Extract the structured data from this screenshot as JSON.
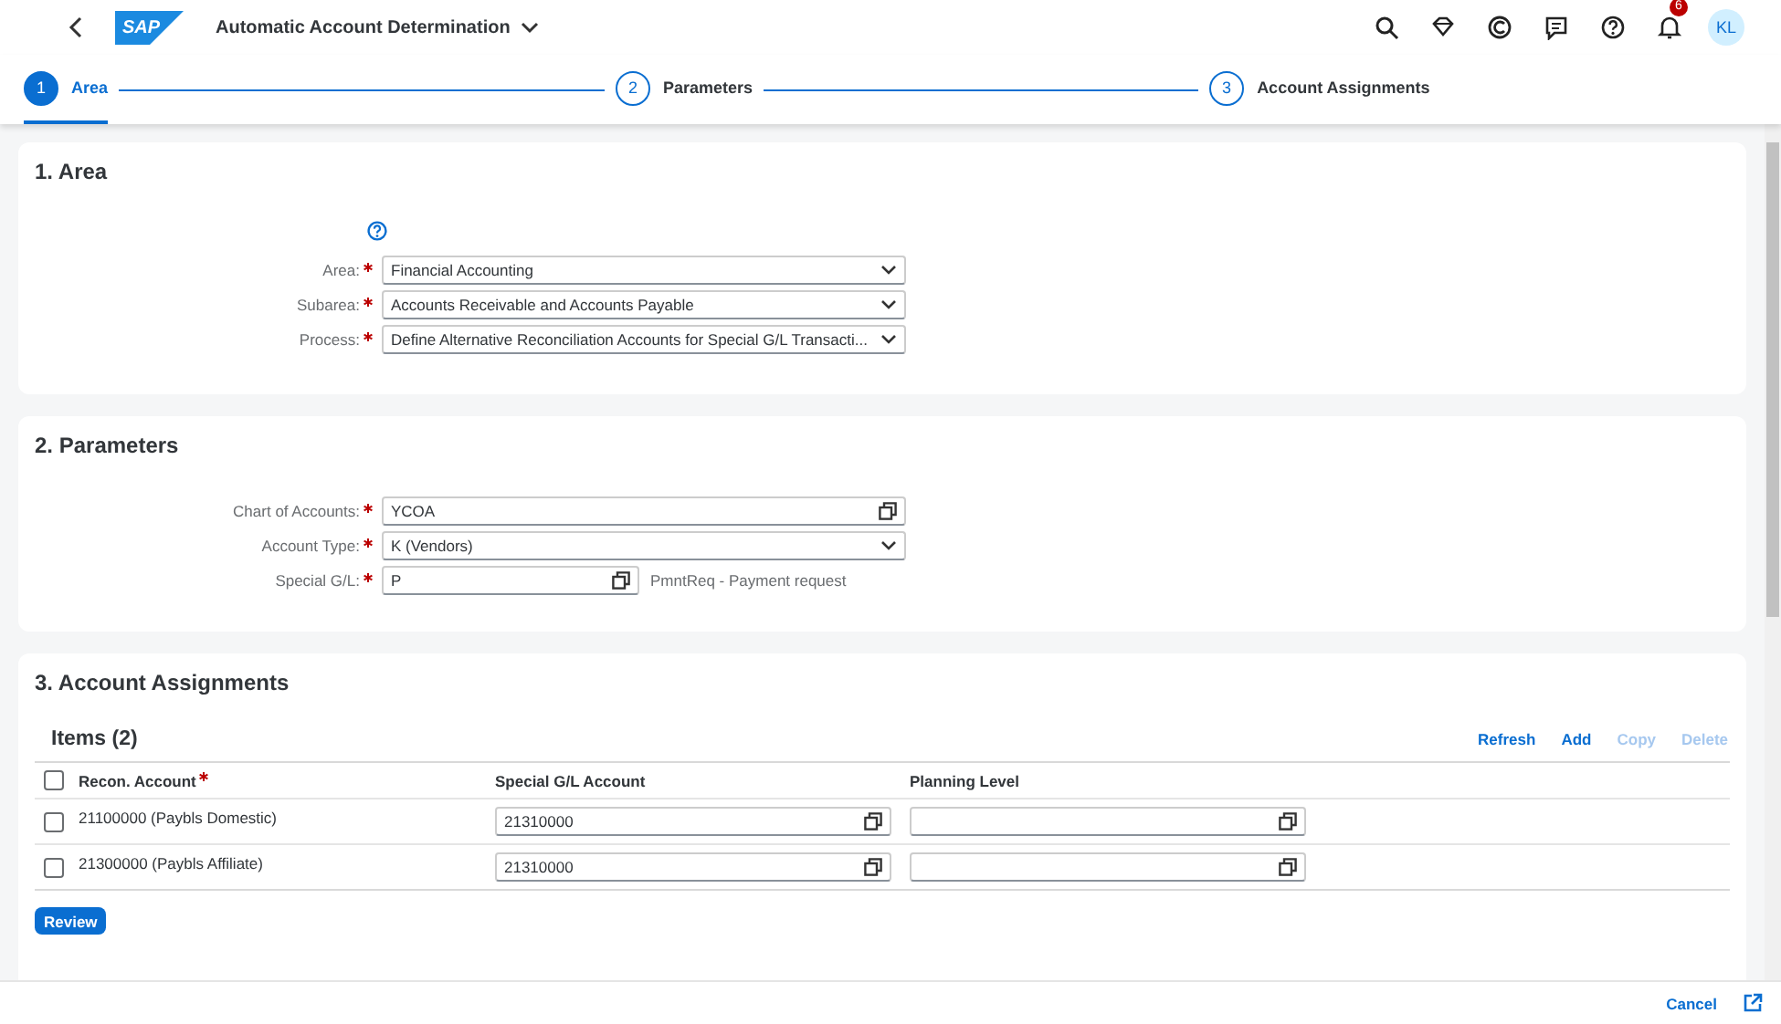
{
  "shell": {
    "logo": "SAP",
    "title": "Automatic Account Determination",
    "notification_count": "6",
    "avatar": "KL"
  },
  "wizard": {
    "steps": [
      {
        "number": "1",
        "label": "Area",
        "selected": true
      },
      {
        "number": "2",
        "label": "Parameters",
        "selected": false
      },
      {
        "number": "3",
        "label": "Account Assignments",
        "selected": false
      }
    ]
  },
  "sections": [
    {
      "kind": "form",
      "title": "1. Area",
      "help": true,
      "fields": [
        {
          "label": "Area:",
          "required": true,
          "kind": "dropdown",
          "value": "Financial Accounting"
        },
        {
          "label": "Subarea:",
          "required": true,
          "kind": "dropdown",
          "value": "Accounts Receivable and Accounts Payable"
        },
        {
          "label": "Process:",
          "required": true,
          "kind": "dropdown",
          "value": "Define Alternative Reconciliation Accounts for Special G/L Transacti..."
        }
      ]
    },
    {
      "kind": "form",
      "title": "2. Parameters",
      "fields": [
        {
          "label": "Chart of Accounts:",
          "required": true,
          "kind": "valuehelp",
          "value": "YCOA"
        },
        {
          "label": "Account Type:",
          "required": true,
          "kind": "dropdown",
          "value": "K (Vendors)"
        },
        {
          "label": "Special G/L:",
          "required": true,
          "kind": "valuehelp_short",
          "value": "P",
          "description": "PmntReq - Payment request"
        }
      ]
    },
    {
      "kind": "table",
      "title": "3. Account Assignments",
      "table_title": "Items (2)",
      "actions": [
        {
          "label": "Refresh",
          "disabled": false
        },
        {
          "label": "Add",
          "disabled": false
        },
        {
          "label": "Copy",
          "disabled": true
        },
        {
          "label": "Delete",
          "disabled": true
        }
      ],
      "select_all": {
        "checked": false
      },
      "columns": [
        {
          "label": "Recon. Account",
          "required": true
        },
        {
          "label": "Special G/L Account",
          "required": false
        },
        {
          "label": "Planning Level",
          "required": false
        }
      ],
      "rows": [
        {
          "checked": false,
          "recon_account": "21100000 (Paybls Domestic)",
          "special_gl_account": "21310000"
        },
        {
          "checked": false,
          "recon_account": "21300000 (Paybls Affiliate)",
          "special_gl_account": "21310000"
        }
      ],
      "button": "Review"
    }
  ],
  "footer": {
    "cancel": "Cancel"
  }
}
